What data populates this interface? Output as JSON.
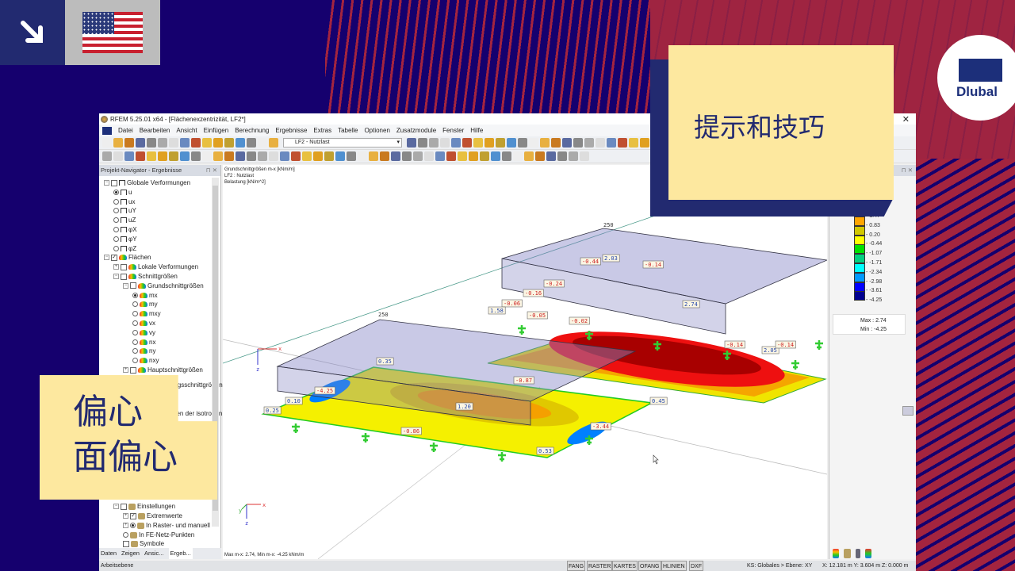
{
  "overlay": {
    "tip_title": "提示和技巧",
    "line1": "偏心",
    "line2": "面偏心",
    "brand": "Dlubal"
  },
  "app": {
    "title": "RFEM 5.25.01 x64 - [Flächenexzentrizität, LF2*]"
  },
  "menu": [
    "Datei",
    "Bearbeiten",
    "Ansicht",
    "Einfügen",
    "Berechnung",
    "Ergebnisse",
    "Extras",
    "Tabelle",
    "Optionen",
    "Zusatzmodule",
    "Fenster",
    "Hilfe"
  ],
  "toolbar": {
    "load_case": "LF2 - Nutzlast"
  },
  "navigator": {
    "title": "Projekt-Navigator - Ergebnisse",
    "items": [
      "Globale Verformungen",
      "u",
      "ux",
      "uY",
      "uZ",
      "φX",
      "φY",
      "φZ",
      "Flächen",
      "Lokale Verformungen",
      "Schnittgrößen",
      "Grundschnittgrößen",
      "mx",
      "my",
      "mxy",
      "vx",
      "vy",
      "nx",
      "ny",
      "nxy",
      "Hauptschnittgrößen",
      "Bemessungsschnittgrößen",
      "Spannungen der isotropen",
      "Einstellungen",
      "Extremwerte",
      "In Raster- und manuell",
      "In FE-Netz-Punkten",
      "Symbole"
    ],
    "tabs": [
      "Daten",
      "Zeigen",
      "Ansic...",
      "Ergeb..."
    ]
  },
  "viewport": {
    "info": [
      "Grundschnittgrößen m-x [kNm/m]",
      "LF2 : Nutzlast",
      "Belastung [kN/m^2]"
    ],
    "footer": "Max m-x: 2.74, Min m-x: -4.25 kNm/m",
    "load_value": "250",
    "labels": [
      "-4.25",
      "0.10",
      "0.25",
      "-0.87",
      "1.20",
      "-0.86",
      "-3.44",
      "0.53",
      "0.45",
      "0.35",
      "2.03",
      "-0.44",
      "-0.14",
      "-0.24",
      "-0.16",
      "-0.06",
      "1.58",
      "-0.05",
      "-0.02",
      "2.74",
      "-0.14",
      "2.05",
      "-0.14"
    ],
    "axis": {
      "x": "x",
      "y": "y",
      "z": "z"
    }
  },
  "legend": {
    "values": [
      "1.47",
      "0.83",
      "0.20",
      "-0.44",
      "-1.07",
      "-1.71",
      "-2.34",
      "-2.98",
      "-3.61",
      "-4.25"
    ],
    "colors": [
      "#ff0000",
      "#ffa500",
      "#d2c800",
      "#ffff00",
      "#00e000",
      "#00d080",
      "#00ffff",
      "#0099ff",
      "#0000ff",
      "#000090"
    ],
    "max_label": "Max",
    "max": "2.74",
    "min_label": "Min",
    "min": "-4.25"
  },
  "status": {
    "left": "Arbeitsebene",
    "buttons": [
      "FANG",
      "RASTER",
      "KARTES",
      "OFANG",
      "HLINIEN",
      "DXF"
    ],
    "cs": "KS: Globales > Ebene: XY",
    "coords": "X: 12.181 m  Y: 3.604 m  Z: 0.000 m"
  }
}
